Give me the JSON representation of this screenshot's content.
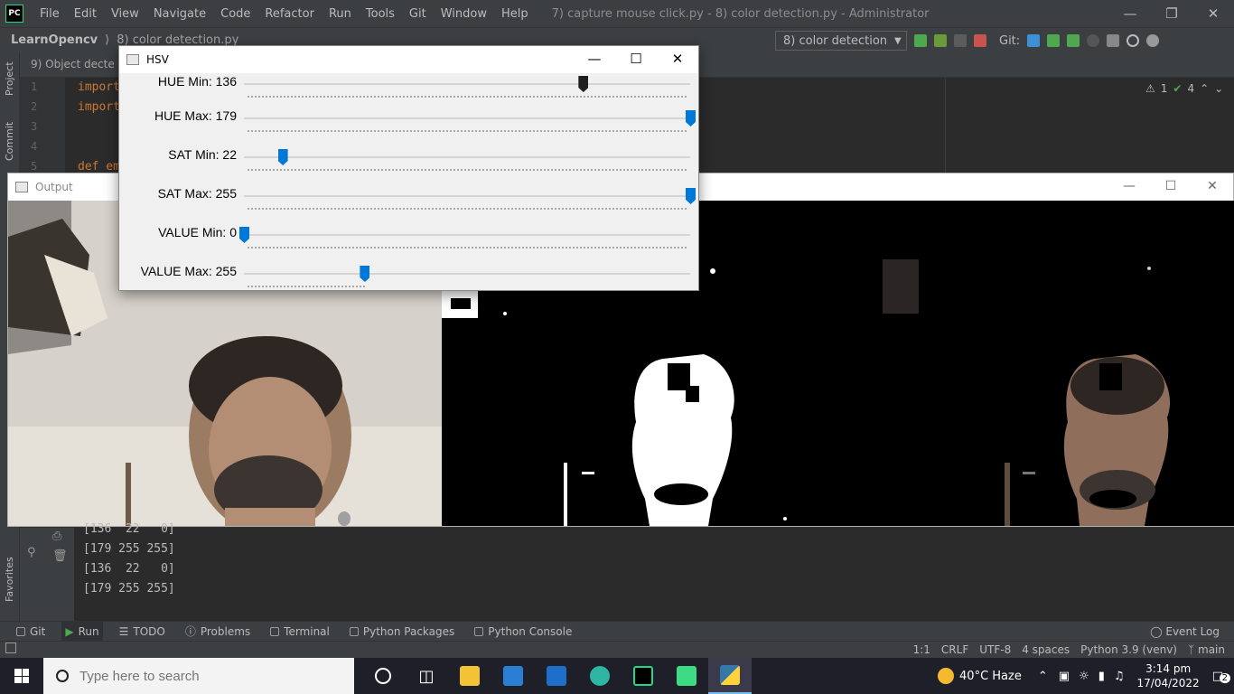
{
  "ide": {
    "logo": "PC",
    "menu": [
      "File",
      "Edit",
      "View",
      "Navigate",
      "Code",
      "Refactor",
      "Run",
      "Tools",
      "Git",
      "Window",
      "Help"
    ],
    "window_title": "7) capture mouse click.py - 8) color detection.py - Administrator",
    "project_name": "LearnOpencv",
    "breadcrumb_file": "8) color detection.py",
    "run_config": "8) color detection",
    "git_label": "Git:",
    "editor_tab": "9) Object decte",
    "inspections": {
      "warnings": "1",
      "checks": "4"
    },
    "left_tools": [
      "Project",
      "Commit",
      "Favorites"
    ],
    "code_lines": [
      {
        "n": "1",
        "text": "import"
      },
      {
        "n": "2",
        "text": "import"
      },
      {
        "n": "3",
        "text": ""
      },
      {
        "n": "4",
        "text": ""
      },
      {
        "n": "5",
        "text": "def em"
      }
    ]
  },
  "hsv_window": {
    "title": "HSV",
    "trackbars": [
      {
        "label": "HUE Min: 136",
        "value": 136,
        "max": 179,
        "accent": "#1e1e1e"
      },
      {
        "label": "HUE Max: 179",
        "value": 179,
        "max": 179,
        "accent": "#0078d7"
      },
      {
        "label": "SAT Min: 22",
        "value": 22,
        "max": 255,
        "accent": "#0078d7"
      },
      {
        "label": "SAT Max: 255",
        "value": 255,
        "max": 255,
        "accent": "#0078d7"
      },
      {
        "label": "VALUE Min: 0",
        "value": 0,
        "max": 255,
        "accent": "#0078d7"
      },
      {
        "label": "VALUE Max: 255",
        "value": 255,
        "max": 255,
        "accent": "#0078d7"
      }
    ]
  },
  "output_window": {
    "title": "Output"
  },
  "console": {
    "lines": [
      "[136  22   0]",
      "[179 255 255]",
      "[136  22   0]",
      "[179 255 255]"
    ]
  },
  "bottom_tabs": [
    "Git",
    "Run",
    "TODO",
    "Problems",
    "Terminal",
    "Python Packages",
    "Python Console"
  ],
  "event_log": "Event Log",
  "status": {
    "position": "1:1",
    "line_sep": "CRLF",
    "encoding": "UTF-8",
    "indent": "4 spaces",
    "interpreter": "Python 3.9 (venv)",
    "branch": "main"
  },
  "taskbar": {
    "search_placeholder": "Type here to search",
    "weather": "40°C  Haze",
    "time": "3:14 pm",
    "date": "17/04/2022",
    "notifications": "2"
  },
  "colors": {
    "ide_bg": "#2b2b2b",
    "ide_panel": "#3c3f41",
    "trackbar_thumb": "#0078d7",
    "taskbar": "#1f1f2a"
  }
}
